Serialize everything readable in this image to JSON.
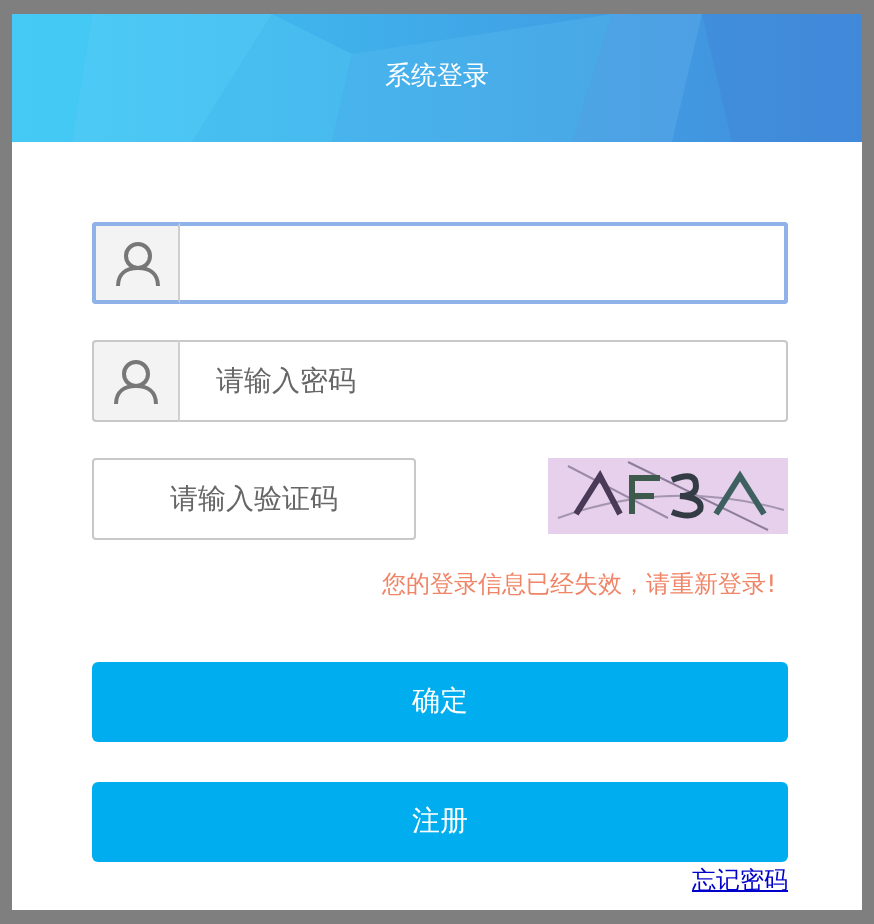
{
  "dialog": {
    "title": "系统登录"
  },
  "fields": [
    {
      "focused": true
    },
    {
      "placeholder": "请输入密码",
      "focused": false
    }
  ],
  "captcha": {
    "placeholder": "请输入验证码"
  },
  "error_message": "您的登录信息已经失效，请重新登录!",
  "buttons": [
    "确定",
    "注册"
  ],
  "forgot_link": "忘记密码"
}
